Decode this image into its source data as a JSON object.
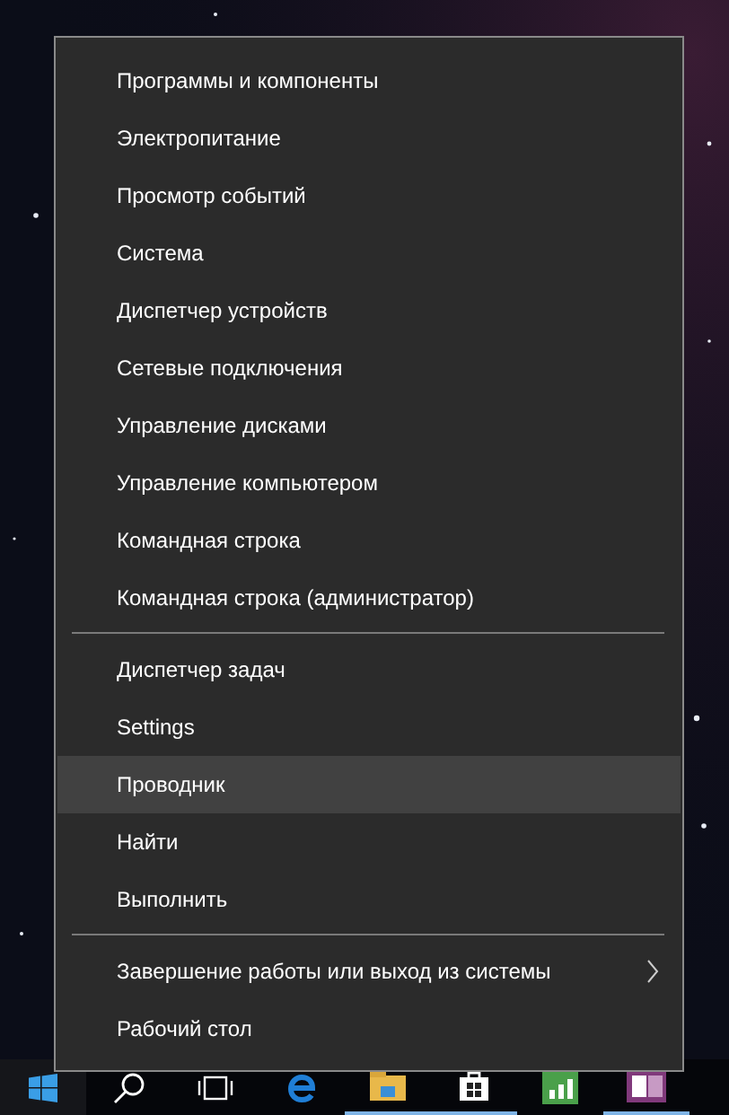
{
  "menu": {
    "groups": [
      {
        "items": [
          {
            "label": "Программы и компоненты",
            "selected": false,
            "submenu": false
          },
          {
            "label": "Электропитание",
            "selected": false,
            "submenu": false
          },
          {
            "label": "Просмотр событий",
            "selected": false,
            "submenu": false
          },
          {
            "label": "Система",
            "selected": false,
            "submenu": false
          },
          {
            "label": "Диспетчер устройств",
            "selected": false,
            "submenu": false
          },
          {
            "label": "Сетевые подключения",
            "selected": false,
            "submenu": false
          },
          {
            "label": "Управление дисками",
            "selected": false,
            "submenu": false
          },
          {
            "label": "Управление компьютером",
            "selected": false,
            "submenu": false
          },
          {
            "label": "Командная строка",
            "selected": false,
            "submenu": false
          },
          {
            "label": "Командная строка (администратор)",
            "selected": false,
            "submenu": false
          }
        ]
      },
      {
        "items": [
          {
            "label": "Диспетчер задач",
            "selected": false,
            "submenu": false
          },
          {
            "label": "Settings",
            "selected": false,
            "submenu": false
          },
          {
            "label": "Проводник",
            "selected": true,
            "submenu": false
          },
          {
            "label": "Найти",
            "selected": false,
            "submenu": false
          },
          {
            "label": "Выполнить",
            "selected": false,
            "submenu": false
          }
        ]
      },
      {
        "items": [
          {
            "label": "Завершение работы или выход из системы",
            "selected": false,
            "submenu": true
          },
          {
            "label": "Рабочий стол",
            "selected": false,
            "submenu": false
          }
        ]
      }
    ]
  },
  "taskbar": {
    "items": [
      {
        "kind": "start",
        "running": false
      },
      {
        "kind": "search",
        "running": false
      },
      {
        "kind": "task-view",
        "running": false
      },
      {
        "kind": "browser",
        "running": false
      },
      {
        "kind": "folder",
        "running": true
      },
      {
        "kind": "store",
        "running": true
      },
      {
        "kind": "chart-app",
        "running": false
      },
      {
        "kind": "note",
        "running": true
      }
    ]
  }
}
